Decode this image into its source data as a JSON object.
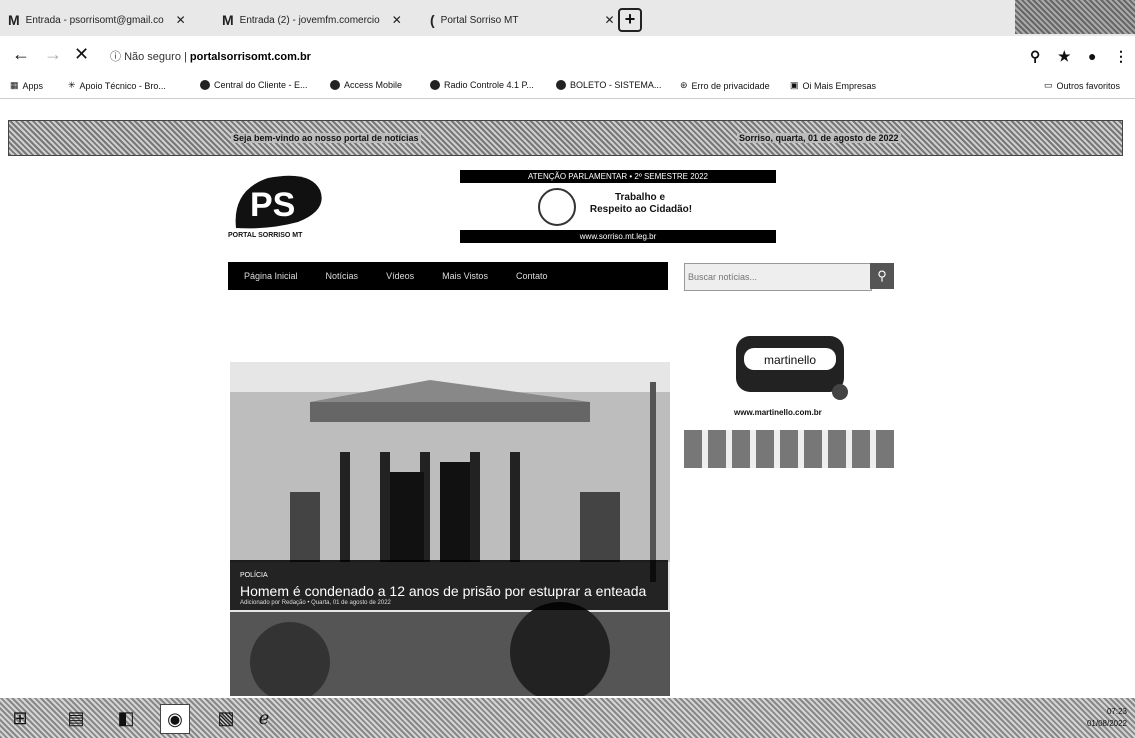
{
  "tabs": [
    {
      "label": "Entrada - psorrisomt@gmail.co",
      "icon": "gmail-icon"
    },
    {
      "label": "Entrada (2) - jovemfm.comercio",
      "icon": "gmail-icon"
    },
    {
      "label": "Portal Sorriso MT",
      "icon": "loading-icon"
    }
  ],
  "address": {
    "security": "Não seguro",
    "url": "portalsorrisomt.com.br"
  },
  "bookmarks": [
    "Apps",
    "Apoio Técnico - Bro...",
    "Central do Cliente - E...",
    "Access Mobile",
    "Radio Controle 4.1 P...",
    "BOLETO - SISTEMA...",
    "Erro de privacidade",
    "Oi Mais Empresas"
  ],
  "bookmarks_other": "Outros favoritos",
  "ticker": {
    "left": "Seja bem-vindo ao nosso portal de notícias",
    "right": "Sorriso, quarta, 01 de agosto de 2022"
  },
  "logo": {
    "mark": "PS",
    "caption": "PORTAL SORRISO MT"
  },
  "banner": {
    "top": "ATENÇÃO PARLAMENTAR • 2º SEMESTRE 2022",
    "line1": "Trabalho e",
    "line2": "Respeito ao Cidadão!",
    "bottom": "www.sorriso.mt.leg.br"
  },
  "nav": [
    "Página Inicial",
    "Notícias",
    "Vídeos",
    "Mais Vistos",
    "Contato"
  ],
  "search": {
    "placeholder": "Buscar notícias..."
  },
  "headline": {
    "category": "POLÍCIA",
    "title": "Homem é condenado a 12 anos de prisão por estuprar a enteada",
    "meta": "Adicionado por Redação • Quarta, 01 de agosto de 2022"
  },
  "ad": {
    "brand": "martinello",
    "url": "www.martinello.com.br"
  },
  "clock": {
    "time": "07:23",
    "date": "01/08/2022"
  }
}
